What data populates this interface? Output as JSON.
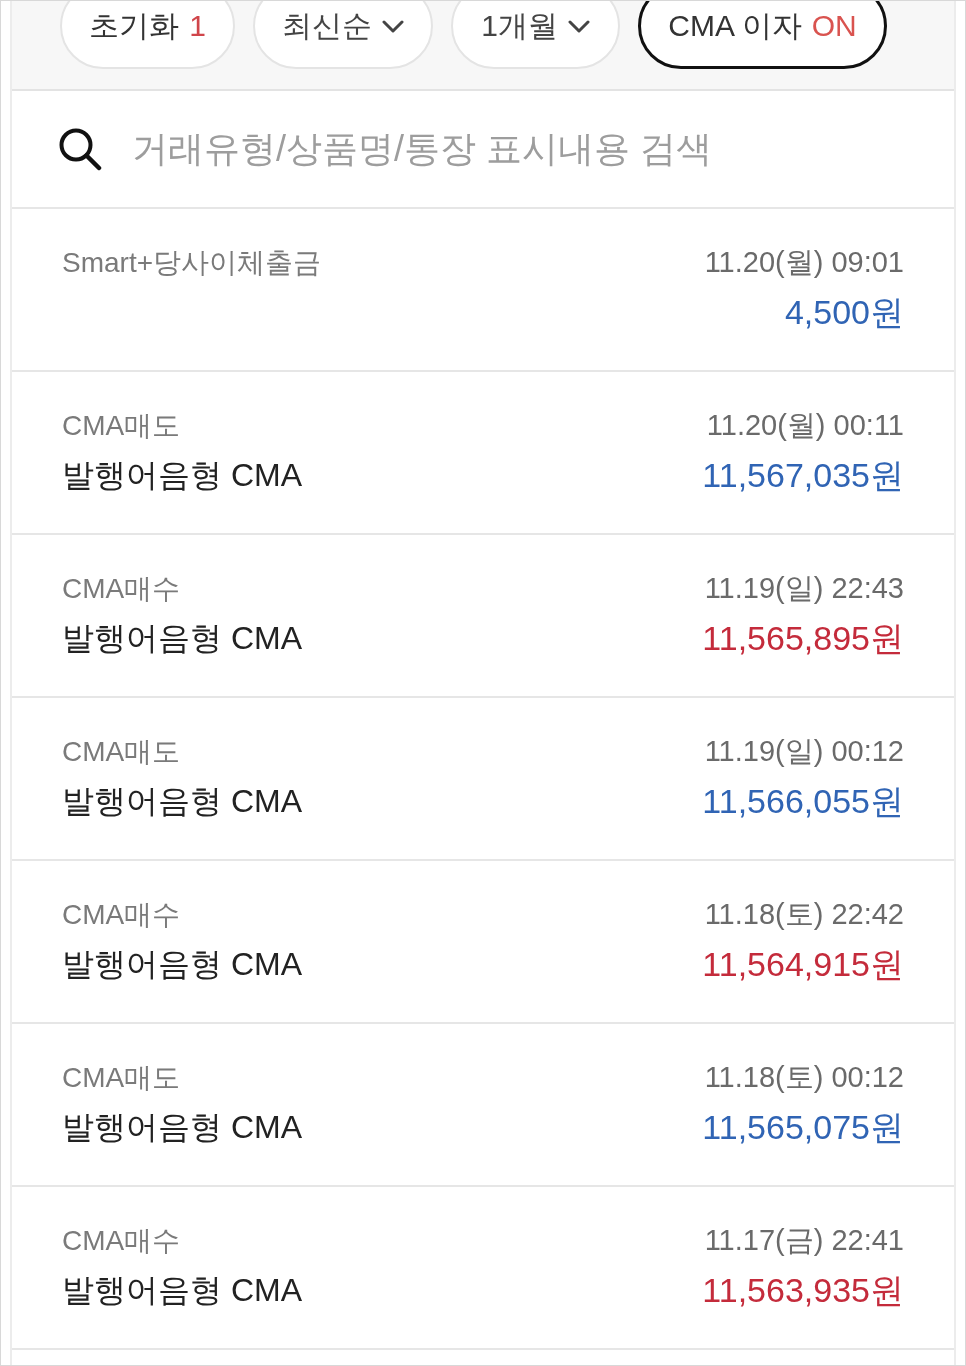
{
  "filters": [
    {
      "kind": "reset",
      "label": "초기화",
      "count": "1",
      "selected": false
    },
    {
      "kind": "dropdown",
      "label": "최신순",
      "selected": false
    },
    {
      "kind": "dropdown",
      "label": "1개월",
      "selected": false
    },
    {
      "kind": "toggle",
      "label": "CMA 이자",
      "value": "ON",
      "selected": true
    }
  ],
  "search": {
    "placeholder": "거래유형/상품명/통장 표시내용 검색"
  },
  "transactions": [
    {
      "type": "Smart+당사이체출금",
      "datetime": "11.20(월) 09:01",
      "amount": "4,500원",
      "color": "#3064b4"
    },
    {
      "type": "CMA매도",
      "title": "발행어음형 CMA",
      "datetime": "11.20(월) 00:11",
      "amount": "11,567,035원",
      "color": "#3064b4"
    },
    {
      "type": "CMA매수",
      "title": "발행어음형 CMA",
      "datetime": "11.19(일) 22:43",
      "amount": "11,565,895원",
      "color": "#c42b3b"
    },
    {
      "type": "CMA매도",
      "title": "발행어음형 CMA",
      "datetime": "11.19(일) 00:12",
      "amount": "11,566,055원",
      "color": "#3064b4"
    },
    {
      "type": "CMA매수",
      "title": "발행어음형 CMA",
      "datetime": "11.18(토) 22:42",
      "amount": "11,564,915원",
      "color": "#c42b3b"
    },
    {
      "type": "CMA매도",
      "title": "발행어음형 CMA",
      "datetime": "11.18(토) 00:12",
      "amount": "11,565,075원",
      "color": "#3064b4"
    },
    {
      "type": "CMA매수",
      "title": "발행어음형 CMA",
      "datetime": "11.17(금) 22:41",
      "amount": "11,563,935원",
      "color": "#c42b3b"
    }
  ]
}
